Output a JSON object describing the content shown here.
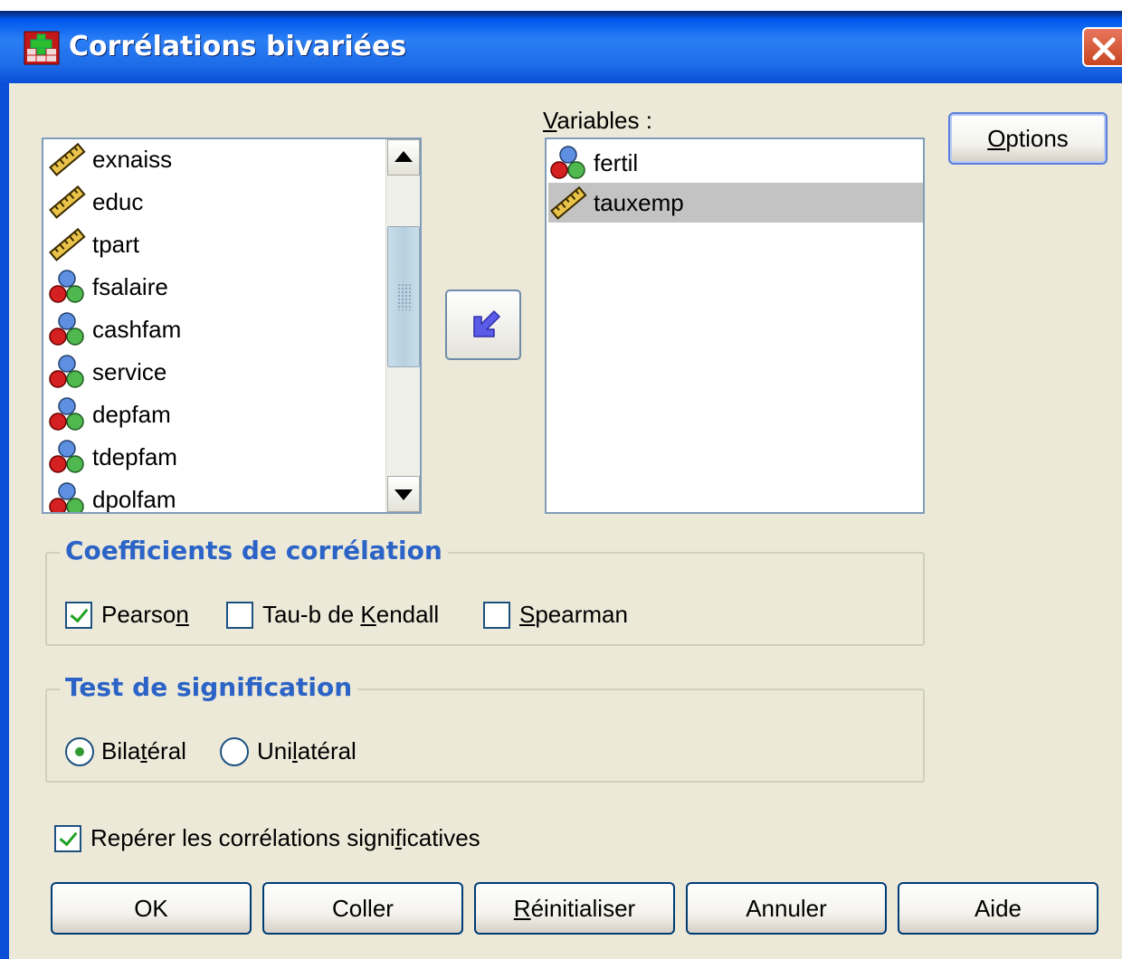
{
  "window": {
    "title": "Corrélations bivariées"
  },
  "source_list": {
    "items": [
      {
        "label": "exnaiss",
        "icon": "ruler-icon"
      },
      {
        "label": "educ",
        "icon": "ruler-icon"
      },
      {
        "label": "tpart",
        "icon": "ruler-icon"
      },
      {
        "label": "fsalaire",
        "icon": "nominal-balls-icon"
      },
      {
        "label": "cashfam",
        "icon": "nominal-balls-icon"
      },
      {
        "label": "service",
        "icon": "nominal-balls-icon"
      },
      {
        "label": "depfam",
        "icon": "nominal-balls-icon"
      },
      {
        "label": "tdepfam",
        "icon": "nominal-balls-icon"
      },
      {
        "label": "dpolfam",
        "icon": "nominal-balls-icon"
      }
    ]
  },
  "variables": {
    "label_first": "V",
    "label_rest": "ariables :",
    "items": [
      {
        "label": "fertil",
        "icon": "nominal-balls-icon",
        "selected": false
      },
      {
        "label": "tauxemp",
        "icon": "ruler-icon",
        "selected": true
      }
    ]
  },
  "options_button": {
    "first": "O",
    "rest": "ptions"
  },
  "coefficients": {
    "legend": "Coefficients de corrélation",
    "pearson": {
      "before": "Pearso",
      "mn": "n",
      "after": "",
      "checked": true
    },
    "kendall": {
      "before": "Tau-b de ",
      "mn": "K",
      "after": "endall",
      "checked": false
    },
    "spearman": {
      "before": "",
      "mn": "S",
      "after": "pearman",
      "checked": false
    }
  },
  "significance": {
    "legend": "Test de signification",
    "bilateral": {
      "before": "Bila",
      "mn": "t",
      "after": "éral",
      "selected": true
    },
    "unilateral": {
      "before": "Uni",
      "mn": "l",
      "after": "atéral",
      "selected": false
    }
  },
  "flag": {
    "before": "Repérer les corrélations signi",
    "mn": "f",
    "after": "icatives",
    "checked": true
  },
  "buttons": {
    "ok": "OK",
    "paste": "Coller",
    "reset_mn": "R",
    "reset_rest": "éinitialiser",
    "cancel": "Annuler",
    "help": "Aide"
  }
}
